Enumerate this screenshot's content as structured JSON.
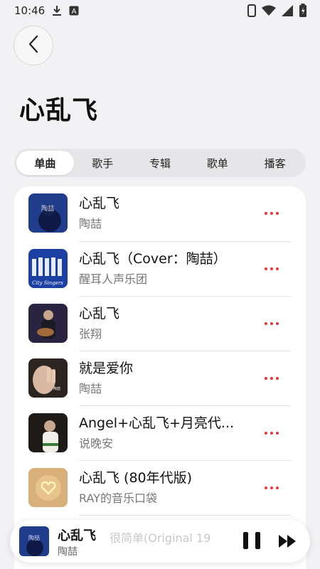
{
  "status_bar": {
    "time": "10:46",
    "icons": [
      "download-icon",
      "a-icon",
      "phone-icon",
      "wifi-icon",
      "signal-icon",
      "battery-icon"
    ]
  },
  "page": {
    "title": "心乱飞"
  },
  "tabs": [
    {
      "label": "单曲",
      "active": true
    },
    {
      "label": "歌手",
      "active": false
    },
    {
      "label": "专辑",
      "active": false
    },
    {
      "label": "歌单",
      "active": false
    },
    {
      "label": "播客",
      "active": false
    }
  ],
  "songs": [
    {
      "title": "心乱飞",
      "artist": "陶喆",
      "cover_color": "#1f3d8a",
      "cover_text": "陶喆"
    },
    {
      "title": "心乱飞（Cover：陶喆）",
      "artist": "醒耳人声乐团",
      "cover_color": "#1c3fa3",
      "cover_text": "City Singers"
    },
    {
      "title": "心乱飞",
      "artist": "张翔",
      "cover_color": "#2a2440"
    },
    {
      "title": "就是爱你",
      "artist": "陶喆",
      "cover_color": "#2b2420"
    },
    {
      "title": "Angel+心乱飞+月亮代...",
      "artist": "说晚安",
      "cover_color": "#b0a89a"
    },
    {
      "title": "心乱飞 (80年代版)",
      "artist": "RAY的音乐口袋",
      "cover_color": "#d9b079"
    }
  ],
  "mini_player": {
    "title": "心乱飞",
    "artist": "陶喆",
    "ghost_text": "很简单(Original 19",
    "cover_text": "陶喆"
  },
  "colors": {
    "accent": "#e0393e",
    "background": "#f2f2f4"
  }
}
